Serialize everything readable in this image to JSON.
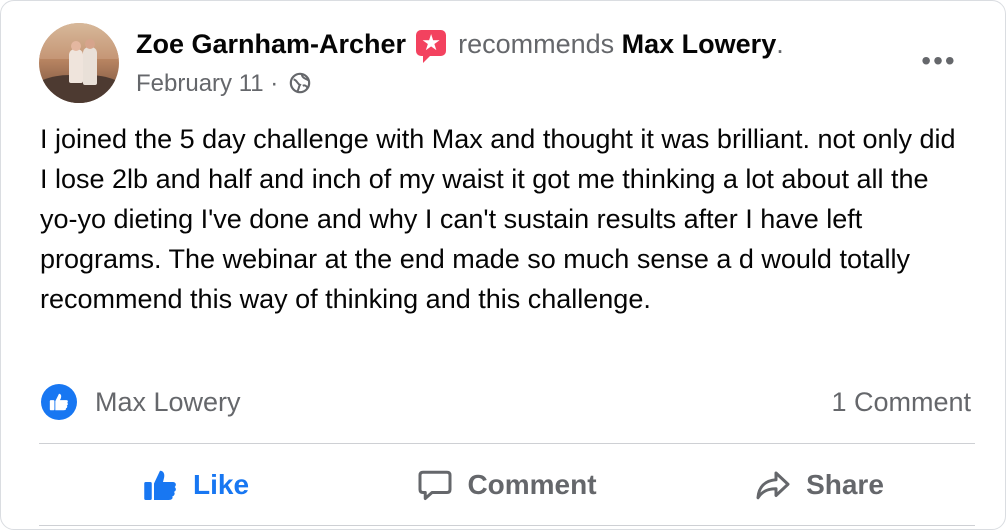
{
  "post": {
    "author": "Zoe Garnham-Archer",
    "action_text": "recommends",
    "target": "Max Lowery",
    "period": ".",
    "date": "February 11",
    "separator": "·",
    "text": "I joined the 5 day challenge with Max and thought it was brilliant. not only did I lose 2lb and half and inch of my waist it got me thinking a lot about all the yo-yo dieting I've done and why I can't sustain results after I have left programs. The webinar at the end made so much sense a d would totally recommend this way of thinking and this challenge."
  },
  "icons": {
    "badge": "recommendation-star-icon",
    "privacy": "globe-icon",
    "menu": "more-options-icon",
    "reaction": "like-reaction-icon"
  },
  "reactions": {
    "reactor": "Max Lowery",
    "comments": "1 Comment"
  },
  "actions": {
    "like": "Like",
    "comment": "Comment",
    "share": "Share"
  },
  "colors": {
    "brand_blue": "#1877f2",
    "secondary_text": "#65676b",
    "recommendation_red": "#f3425f"
  }
}
